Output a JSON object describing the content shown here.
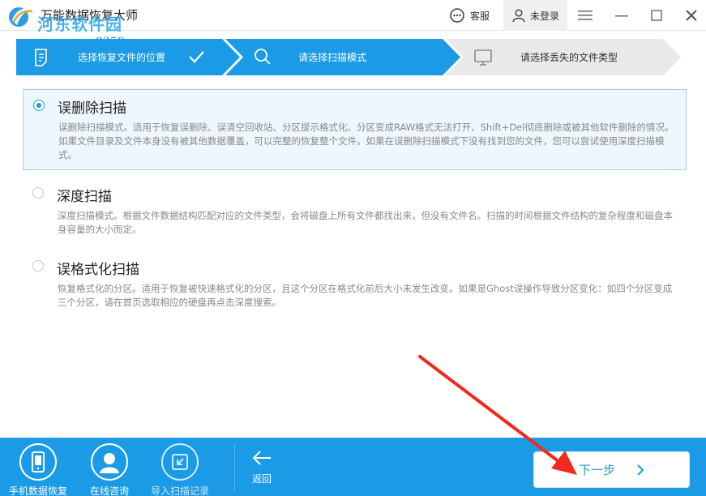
{
  "window": {
    "title": "万能数据恢复大师",
    "watermark_text": "河东软件园",
    "watermark_url": "www.pc0359.cn",
    "service_label": "客服",
    "login_label": "未登录"
  },
  "steps": [
    {
      "label": "选择恢复文件的位置",
      "icon": "document-icon",
      "state": "done"
    },
    {
      "label": "请选择扫描模式",
      "icon": "search-icon",
      "state": "active"
    },
    {
      "label": "请选择丢失的文件类型",
      "icon": "monitor-icon",
      "state": "pending"
    }
  ],
  "scan_options": [
    {
      "title": "误删除扫描",
      "selected": true,
      "description": "误删除扫描模式。适用于恢复误删除、误清空回收站、分区提示格式化、分区变成RAW格式无法打开、Shift+Del彻底删除或被其他软件删除的情况。如果文件目录及文件本身没有被其他数据覆盖，可以完整的恢复整个文件。如果在误删除扫描模式下没有找到您的文件，您可以尝试使用深度扫描模式。"
    },
    {
      "title": "深度扫描",
      "selected": false,
      "description": "深度扫描模式。根据文件数据结构匹配对应的文件类型，会将磁盘上所有文件都找出来，但没有文件名。扫描的时间根据文件结构的复杂程度和磁盘本身容量的大小而定。"
    },
    {
      "title": "误格式化扫描",
      "selected": false,
      "description": "恢复格式化的分区。适用于恢复被快速格式化的分区，且这个分区在格式化前后大小未发生改变。如果是Ghost误操作导致分区变化：如四个分区变成三个分区，请在首页选取相应的硬盘再点击深度搜索。"
    }
  ],
  "bottom_bar": {
    "phone_recovery": "手机数据恢复",
    "online_consult": "在线咨询",
    "import_scan": "导入扫描记录",
    "back": "返回",
    "next": "下一步"
  },
  "colors": {
    "accent": "#1b9be6",
    "step_done": "#1b9be6",
    "step_pending": "#e9e9e9",
    "annotation_arrow": "#f02a1e"
  }
}
